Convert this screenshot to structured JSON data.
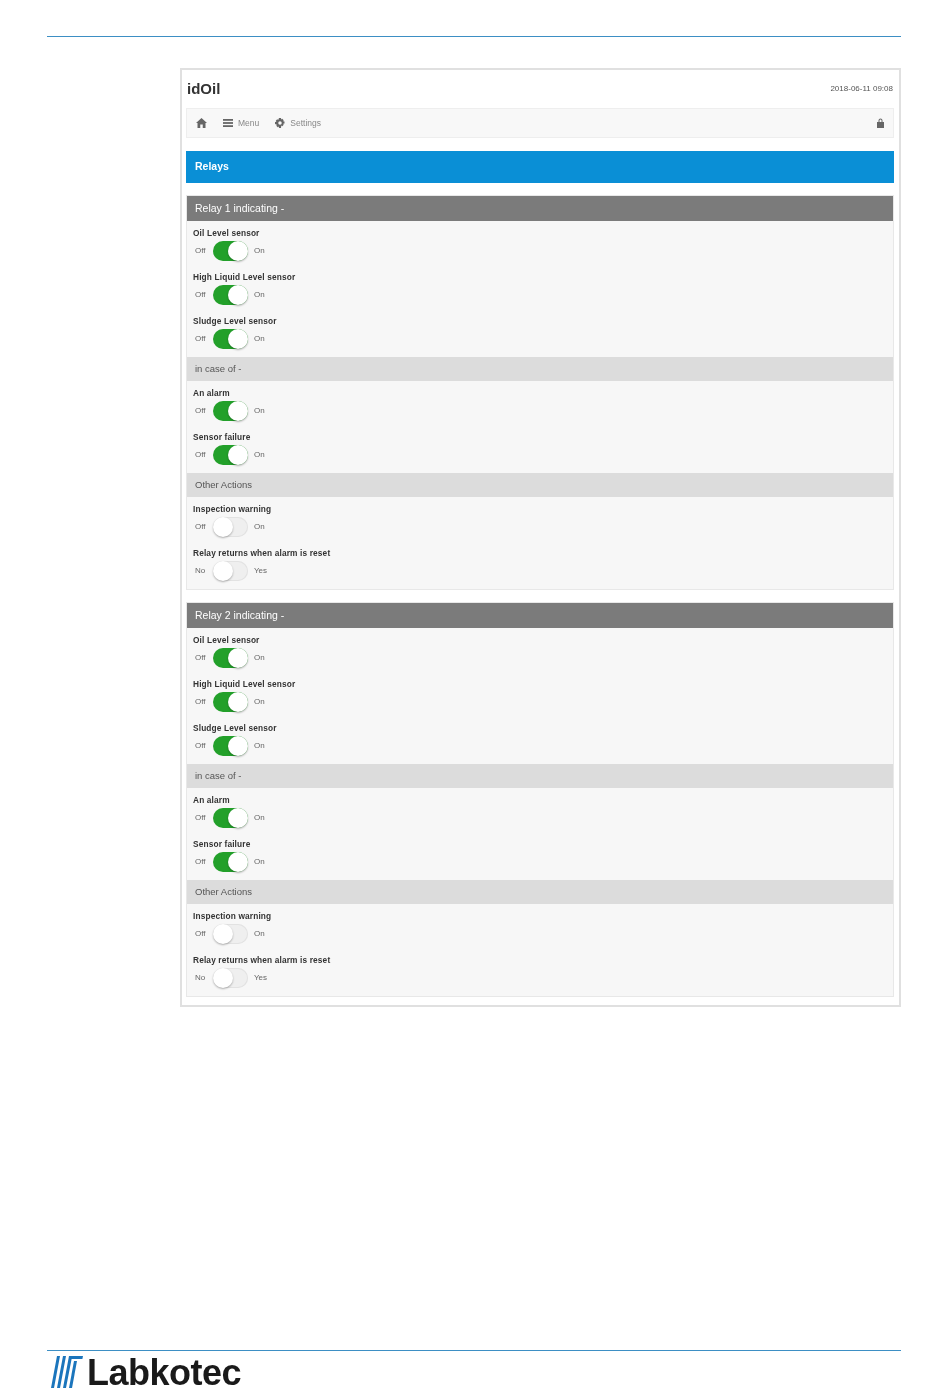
{
  "header": {
    "title": "idOil",
    "datetime": "2018-06-11 09:08"
  },
  "navbar": {
    "links": [
      {
        "kind": "menu",
        "label": "Menu"
      },
      {
        "kind": "settings",
        "label": "Settings"
      }
    ]
  },
  "page_title": "Relays",
  "relays": [
    {
      "title": "Relay 1 indicating -",
      "sections": [
        {
          "items": [
            {
              "label": "Oil Level sensor",
              "off_label": "Off",
              "on_label": "On",
              "on": true
            },
            {
              "label": "High Liquid Level sensor",
              "off_label": "Off",
              "on_label": "On",
              "on": true
            },
            {
              "label": "Sludge Level sensor",
              "off_label": "Off",
              "on_label": "On",
              "on": true
            }
          ]
        },
        {
          "heading": "in case of -",
          "items": [
            {
              "label": "An alarm",
              "off_label": "Off",
              "on_label": "On",
              "on": true
            },
            {
              "label": "Sensor failure",
              "off_label": "Off",
              "on_label": "On",
              "on": true
            }
          ]
        },
        {
          "heading": "Other Actions",
          "items": [
            {
              "label": "Inspection warning",
              "off_label": "Off",
              "on_label": "On",
              "on": false
            },
            {
              "label": "Relay returns when alarm is reset",
              "off_label": "No",
              "on_label": "Yes",
              "on": false
            }
          ]
        }
      ]
    },
    {
      "title": "Relay 2 indicating -",
      "sections": [
        {
          "items": [
            {
              "label": "Oil Level sensor",
              "off_label": "Off",
              "on_label": "On",
              "on": true
            },
            {
              "label": "High Liquid Level sensor",
              "off_label": "Off",
              "on_label": "On",
              "on": true
            },
            {
              "label": "Sludge Level sensor",
              "off_label": "Off",
              "on_label": "On",
              "on": true
            }
          ]
        },
        {
          "heading": "in case of -",
          "items": [
            {
              "label": "An alarm",
              "off_label": "Off",
              "on_label": "On",
              "on": true
            },
            {
              "label": "Sensor failure",
              "off_label": "Off",
              "on_label": "On",
              "on": true
            }
          ]
        },
        {
          "heading": "Other Actions",
          "items": [
            {
              "label": "Inspection warning",
              "off_label": "Off",
              "on_label": "On",
              "on": false
            },
            {
              "label": "Relay returns when alarm is reset",
              "off_label": "No",
              "on_label": "Yes",
              "on": false
            }
          ]
        }
      ]
    }
  ],
  "footer": {
    "brand": "Labkotec"
  }
}
